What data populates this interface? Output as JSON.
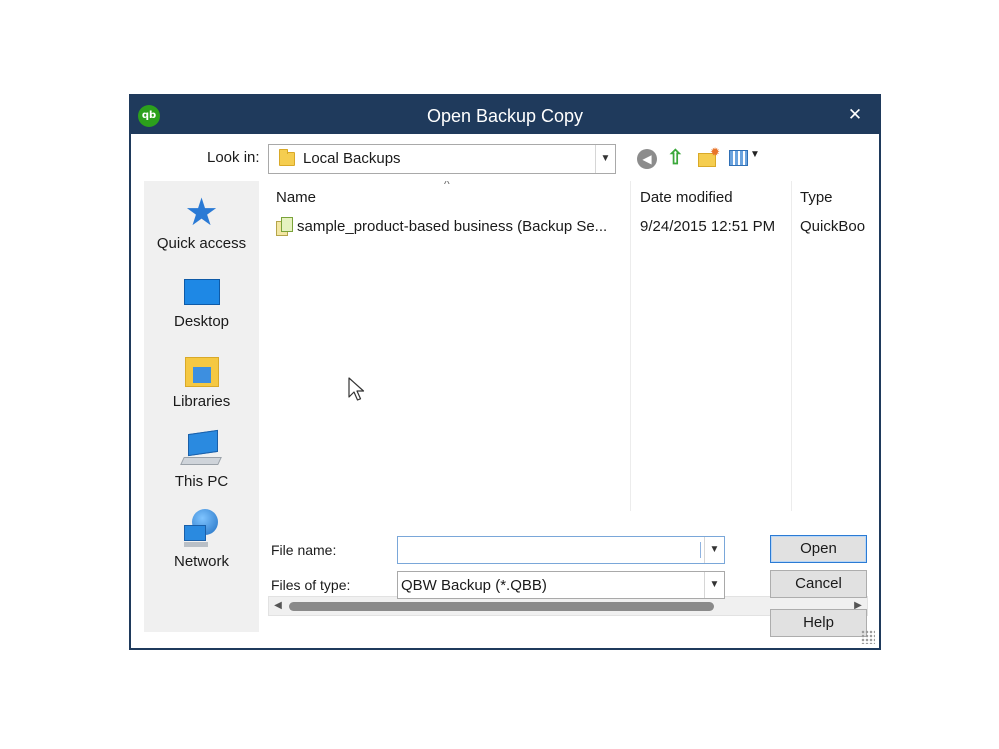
{
  "dialog": {
    "title": "Open Backup Copy",
    "logo_text": "qb",
    "close_glyph": "✕"
  },
  "lookin": {
    "label": "Look in:",
    "value": "Local Backups"
  },
  "places": [
    {
      "label": "Quick access",
      "icon": "star-icon"
    },
    {
      "label": "Desktop",
      "icon": "desktop-icon"
    },
    {
      "label": "Libraries",
      "icon": "libraries-icon"
    },
    {
      "label": "This PC",
      "icon": "this-pc-icon"
    },
    {
      "label": "Network",
      "icon": "network-icon"
    }
  ],
  "columns": {
    "name": "Name",
    "date": "Date modified",
    "type": "Type"
  },
  "files": [
    {
      "name": "sample_product-based business (Backup Se...",
      "date": "9/24/2015 12:51 PM",
      "type": "QuickBoo"
    }
  ],
  "form": {
    "file_name_label": "File name:",
    "file_name_value": "",
    "files_of_type_label": "Files of type:",
    "files_of_type_value": "QBW Backup (*.QBB)"
  },
  "buttons": {
    "open": "Open",
    "cancel": "Cancel",
    "help": "Help"
  },
  "colors": {
    "titlebar": "#1f3a5c",
    "qb_green": "#2ca01c"
  }
}
